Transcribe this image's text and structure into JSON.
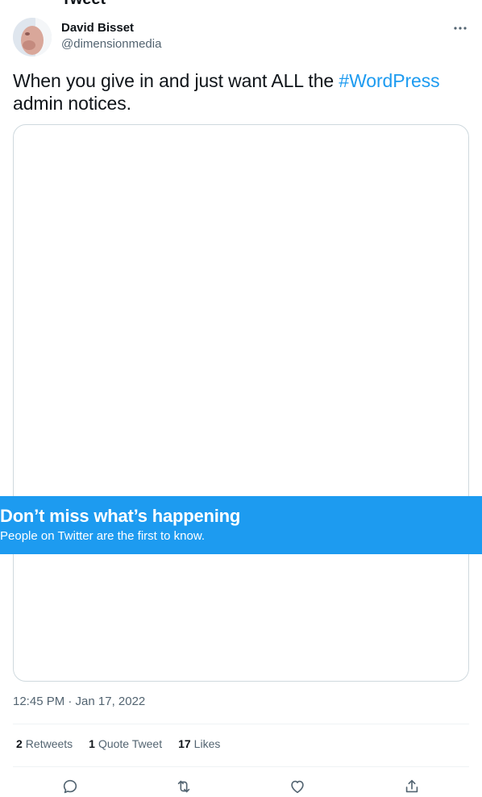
{
  "page": {
    "cut_off_title": "Tweet"
  },
  "tweet": {
    "author_name": "David Bisset",
    "author_handle": "@dimensionmedia",
    "text_before": "When you give in and just want ALL the ",
    "hashtag": "#WordPress",
    "text_after": "admin notices.",
    "timestamp": "12:45 PM · Jan 17, 2022"
  },
  "stats": {
    "retweets_count": "2",
    "retweets_label": "Retweets",
    "quotes_count": "1",
    "quotes_label": "Quote Tweet",
    "likes_count": "17",
    "likes_label": "Likes"
  },
  "banner": {
    "title": "Don’t miss what’s happening",
    "subtitle": "People on Twitter are the first to know."
  },
  "icons": {
    "more": "more-icon",
    "reply": "reply-icon",
    "retweet": "retweet-icon",
    "like": "heart-icon",
    "share": "share-icon"
  },
  "colors": {
    "accent": "#1d9bf0",
    "text": "#0f1419",
    "secondary": "#536471",
    "border": "#cfd9de"
  }
}
